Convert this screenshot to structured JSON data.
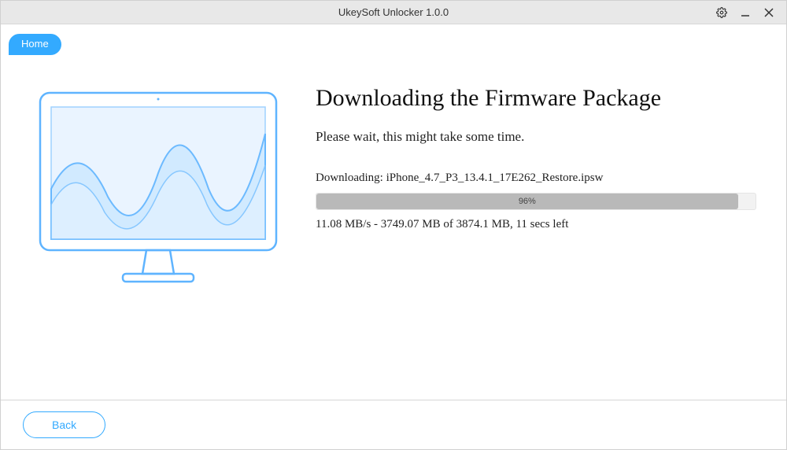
{
  "window": {
    "title": "UkeySoft Unlocker 1.0.0"
  },
  "tabs": {
    "home_label": "Home"
  },
  "main": {
    "heading": "Downloading the Firmware Package",
    "subtext": "Please wait, this might take some time.",
    "file_prefix": "Downloading: ",
    "file_name": "iPhone_4.7_P3_13.4.1_17E262_Restore.ipsw",
    "progress_percent": 96,
    "progress_label": "96%",
    "status_line": "11.08 MB/s - 3749.07 MB of 3874.1 MB, 11 secs left"
  },
  "footer": {
    "back_label": "Back"
  },
  "icons": {
    "settings": "gear-icon",
    "minimize": "minimize-icon",
    "close": "close-icon"
  },
  "colors": {
    "accent": "#33aaff",
    "titlebar_bg": "#e8e8e8",
    "progress_fill": "#b9b9b9"
  }
}
